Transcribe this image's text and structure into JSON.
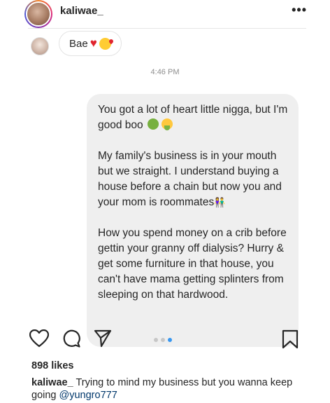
{
  "header": {
    "username": "kaliwae_",
    "more_label": "•••"
  },
  "chat": {
    "incoming": {
      "text": "Bae",
      "emoji": [
        "heart",
        "face-blowing-kiss"
      ]
    },
    "timestamp": "4:46 PM",
    "outgoing": {
      "para1_line": "You got a lot of heart little nigga, but I'm good boo",
      "para2": "My family's business is in your mouth but we straight. I understand buying a house before a chain but now you and your mom is roommates",
      "para3": "How you spend money on a crib before gettin your granny off dialysis? Hurry & get some furniture in that house, you can't have mama getting splinters from sleeping on that hardwood."
    }
  },
  "actions": {
    "icons": [
      "heart-icon",
      "comment-icon",
      "share-icon",
      "bookmark-icon"
    ],
    "carousel": {
      "count": 3,
      "active_index": 2
    }
  },
  "post": {
    "likes": "898 likes",
    "caption_user": "kaliwae_",
    "caption_text": "Trying to mind my business but you wanna keep going",
    "caption_mention": "@yungro777"
  },
  "colors": {
    "accent_blue": "#3897f0",
    "bubble_gray": "#efefef",
    "text": "#262626",
    "muted": "#8e8e8e"
  }
}
